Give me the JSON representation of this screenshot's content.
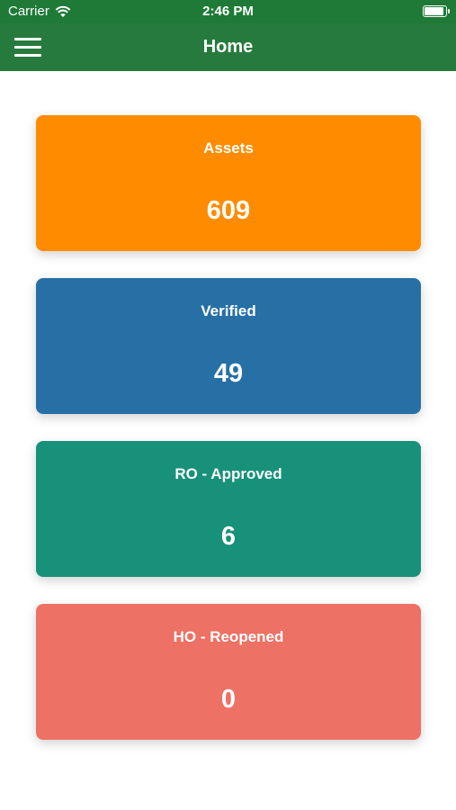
{
  "status_bar": {
    "carrier": "Carrier",
    "time": "2:46 PM",
    "battery_level": 1.0
  },
  "nav": {
    "title": "Home",
    "menu_icon": "hamburger-menu-icon"
  },
  "cards": [
    {
      "label": "Assets",
      "value": "609",
      "color": "#ff8c00"
    },
    {
      "label": "Verified",
      "value": "49",
      "color": "#2670a6"
    },
    {
      "label": "RO - Approved",
      "value": "6",
      "color": "#17917a"
    },
    {
      "label": "HO - Reopened",
      "value": "0",
      "color": "#ed7164"
    }
  ]
}
